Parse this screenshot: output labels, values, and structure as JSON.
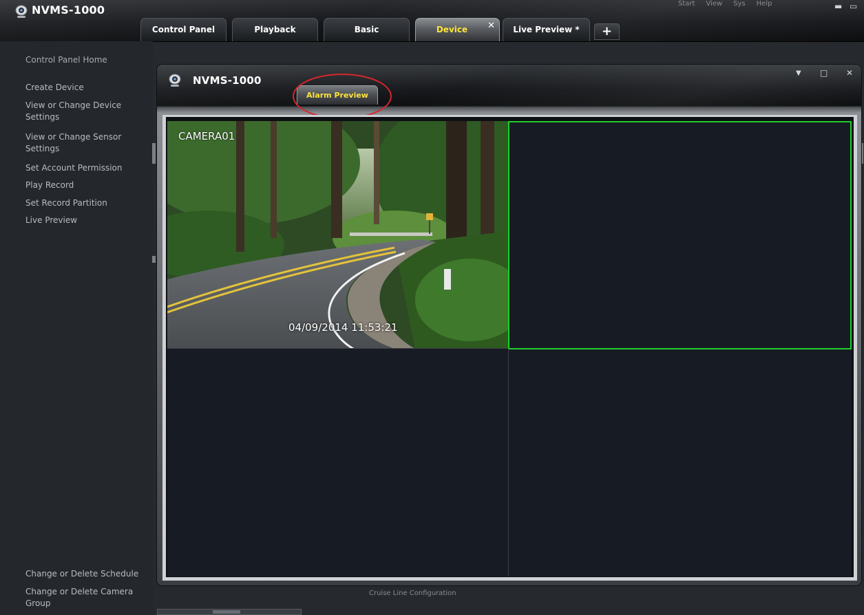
{
  "app": {
    "title": "NVMS-1000",
    "top_menu": [
      "Start",
      "View",
      "Sys",
      "Help"
    ],
    "window_controls": {
      "minimize": "▬",
      "restore": "▭"
    }
  },
  "tabs": [
    {
      "label": "Control Panel",
      "active": false
    },
    {
      "label": "Playback",
      "active": false
    },
    {
      "label": "Basic",
      "active": false
    },
    {
      "label": "Device",
      "active": true,
      "close": "✕"
    },
    {
      "label": "Live Preview *",
      "active": false
    }
  ],
  "add_tab_label": "+",
  "sidebar": {
    "home": "Control Panel Home",
    "items": [
      "Create Device",
      "View or Change Device Settings",
      "View or Change Sensor Settings",
      "Set Account Permission",
      "Play Record",
      "Set Record Partition",
      "Live Preview"
    ],
    "bottom_items": [
      "Change or Delete Schedule",
      "Change or Delete Camera Group"
    ]
  },
  "inner_window": {
    "title": "NVMS-1000",
    "tab_label": "Alarm Preview",
    "controls": {
      "menu": "▼",
      "maximize": "□",
      "close": "✕"
    }
  },
  "video_grid": {
    "cells": [
      {
        "camera": "CAMERA01",
        "timestamp": "04/09/2014  11:53:21",
        "has_video": true
      },
      {
        "camera": "",
        "timestamp": "",
        "has_video": false,
        "selected": true
      },
      {
        "camera": "",
        "timestamp": "",
        "has_video": false
      },
      {
        "camera": "",
        "timestamp": "",
        "has_video": false
      }
    ]
  },
  "status_bar": {
    "text": "Cruise Line Configuration"
  },
  "colors": {
    "accent_tab_text": "#ffe33a",
    "selection_border": "#1fcf2a",
    "highlight_ring": "#d8262b",
    "background": "#26292e"
  }
}
